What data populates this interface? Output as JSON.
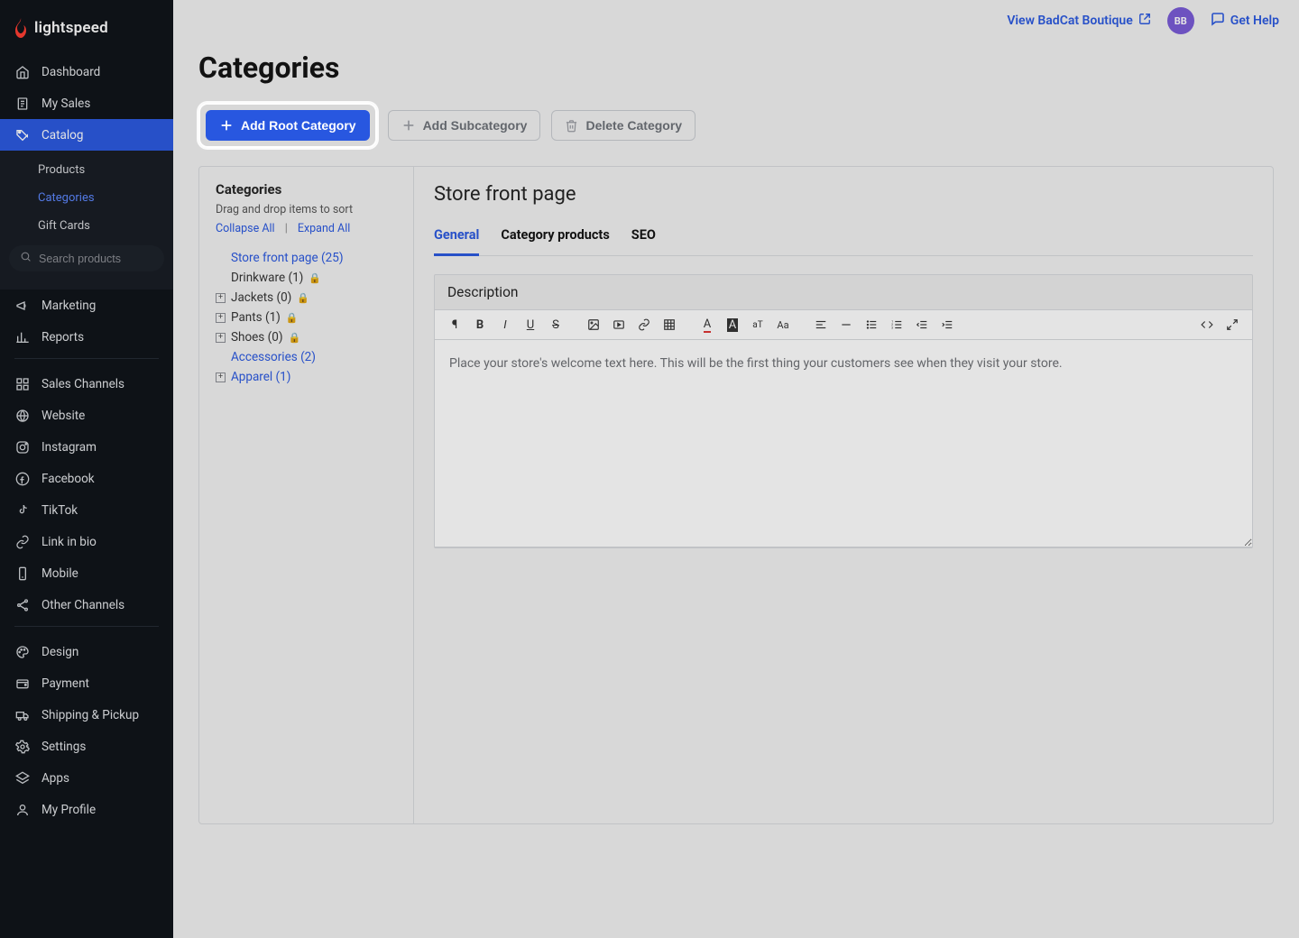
{
  "brand": {
    "name": "lightspeed"
  },
  "topbar": {
    "view_store": "View BadCat Boutique",
    "avatar_initials": "BB",
    "help": "Get Help"
  },
  "sidebar": {
    "search_placeholder": "Search products",
    "items": [
      {
        "icon": "home-icon",
        "label": "Dashboard"
      },
      {
        "icon": "receipt-icon",
        "label": "My Sales"
      },
      {
        "icon": "tag-icon",
        "label": "Catalog",
        "selected": true,
        "sub": [
          {
            "label": "Products"
          },
          {
            "label": "Categories",
            "active": true
          },
          {
            "label": "Gift Cards"
          }
        ]
      },
      {
        "icon": "megaphone-icon",
        "label": "Marketing"
      },
      {
        "icon": "chart-icon",
        "label": "Reports"
      },
      {
        "divider": true
      },
      {
        "icon": "grid-icon",
        "label": "Sales Channels"
      },
      {
        "icon": "globe-icon",
        "label": "Website"
      },
      {
        "icon": "instagram-icon",
        "label": "Instagram"
      },
      {
        "icon": "facebook-icon",
        "label": "Facebook"
      },
      {
        "icon": "tiktok-icon",
        "label": "TikTok"
      },
      {
        "icon": "link-icon",
        "label": "Link in bio"
      },
      {
        "icon": "mobile-icon",
        "label": "Mobile"
      },
      {
        "icon": "share-icon",
        "label": "Other Channels"
      },
      {
        "divider": true
      },
      {
        "icon": "palette-icon",
        "label": "Design"
      },
      {
        "icon": "wallet-icon",
        "label": "Payment"
      },
      {
        "icon": "truck-icon",
        "label": "Shipping & Pickup"
      },
      {
        "icon": "gear-icon",
        "label": "Settings"
      },
      {
        "icon": "layers-icon",
        "label": "Apps"
      },
      {
        "icon": "user-icon",
        "label": "My Profile"
      }
    ]
  },
  "page": {
    "title": "Categories",
    "actions": {
      "add_root": "Add Root Category",
      "add_sub": "Add Subcategory",
      "delete": "Delete Category"
    },
    "tree": {
      "title": "Categories",
      "help": "Drag and drop items to sort",
      "collapse": "Collapse All",
      "expand": "Expand All",
      "items": [
        {
          "label": "Store front page (25)",
          "link": true,
          "expandable": false
        },
        {
          "label": "Drinkware (1)",
          "link": false,
          "expandable": false,
          "locked": true
        },
        {
          "label": "Jackets (0)",
          "link": false,
          "expandable": true,
          "locked": true
        },
        {
          "label": "Pants (1)",
          "link": false,
          "expandable": true,
          "locked": true
        },
        {
          "label": "Shoes (0)",
          "link": false,
          "expandable": true,
          "locked": true
        },
        {
          "label": "Accessories (2)",
          "link": true,
          "expandable": false
        },
        {
          "label": "Apparel (1)",
          "link": true,
          "expandable": true
        }
      ]
    },
    "detail": {
      "title": "Store front page",
      "tabs": [
        {
          "label": "General",
          "active": true
        },
        {
          "label": "Category products"
        },
        {
          "label": "SEO"
        }
      ],
      "description_heading": "Description",
      "editor_placeholder": "Place your store's welcome text here. This will be the first thing your customers see when they visit your store."
    }
  }
}
